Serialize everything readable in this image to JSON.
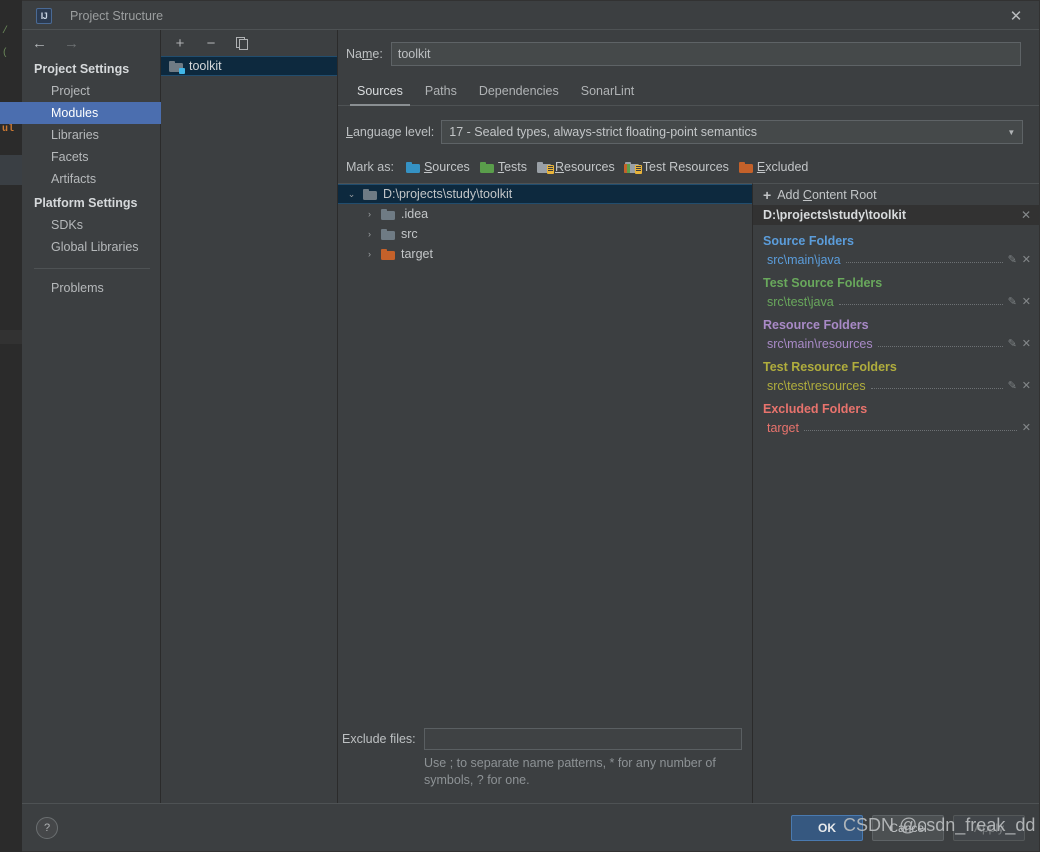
{
  "window": {
    "title": "Project Structure",
    "app_icon": "intellij-idea-icon",
    "close_label": "✕"
  },
  "nav": {
    "back_icon": "←",
    "forward_icon": "→",
    "groups": [
      {
        "label": "Project Settings",
        "items": [
          {
            "label": "Project",
            "selected": false
          },
          {
            "label": "Modules",
            "selected": true
          },
          {
            "label": "Libraries",
            "selected": false
          },
          {
            "label": "Facets",
            "selected": false
          },
          {
            "label": "Artifacts",
            "selected": false
          }
        ]
      },
      {
        "label": "Platform Settings",
        "items": [
          {
            "label": "SDKs",
            "selected": false
          },
          {
            "label": "Global Libraries",
            "selected": false
          }
        ]
      }
    ],
    "problems": "Problems"
  },
  "modules": {
    "toolbar": {
      "add": "+",
      "remove": "−",
      "copy": "copy-icon"
    },
    "items": [
      {
        "label": "toolkit",
        "selected": true
      }
    ]
  },
  "detail": {
    "name_label_pre": "Na",
    "name_label_mnemonic": "m",
    "name_label_post": "e:",
    "name_value": "toolkit",
    "name_placeholder": "",
    "tabs": [
      {
        "label": "Sources",
        "active": true
      },
      {
        "label": "Paths",
        "active": false
      },
      {
        "label": "Dependencies",
        "active": false
      },
      {
        "label": "SonarLint",
        "active": false
      }
    ],
    "language_level": {
      "label_pre": "",
      "label_mnemonic": "L",
      "label_post": "anguage level:",
      "value": "17 - Sealed types, always-strict floating-point semantics",
      "caret": "▼"
    },
    "mark_as": {
      "label": "Mark as:",
      "options": [
        {
          "label": "Sources",
          "mnemonic": "S",
          "rest": "ources",
          "icon": "folder-sources-icon",
          "color": "#3592c4"
        },
        {
          "label": "Tests",
          "mnemonic": "T",
          "rest": "ests",
          "icon": "folder-tests-icon",
          "color": "#5a9e4b"
        },
        {
          "label": "Resources",
          "mnemonic": "R",
          "rest": "esources",
          "icon": "folder-resources-icon",
          "color": "#9aa0a6"
        },
        {
          "label": "Test Resources",
          "mnemonic": "",
          "rest": "Test Resources",
          "icon": "folder-test-resources-icon",
          "color": "#9aa0a6"
        },
        {
          "label": "Excluded",
          "mnemonic": "E",
          "rest": "xcluded",
          "icon": "folder-excluded-icon",
          "color": "#c4612a"
        }
      ]
    },
    "tree": [
      {
        "label": "D:\\projects\\study\\toolkit",
        "twisty": "⌄",
        "indent": 0,
        "folder": "blue",
        "selected": true
      },
      {
        "label": ".idea",
        "twisty": "›",
        "indent": 1,
        "folder": "blue",
        "selected": false
      },
      {
        "label": "src",
        "twisty": "›",
        "indent": 1,
        "folder": "blue",
        "selected": false
      },
      {
        "label": "target",
        "twisty": "›",
        "indent": 1,
        "folder": "orange",
        "selected": false
      }
    ],
    "exclude": {
      "label": "Exclude files:",
      "value": "",
      "placeholder": "",
      "hint": "Use ; to separate name patterns, * for any number of symbols, ? for one."
    }
  },
  "roots": {
    "add_content_root": {
      "plus": "+",
      "text_pre": "Add ",
      "mnemonic": "C",
      "text_post": "ontent Root"
    },
    "root_path": "D:\\projects\\study\\toolkit",
    "root_close": "✕",
    "categories": [
      {
        "title": "Source Folders",
        "color_class": "c-src",
        "color": "#5b9ddb",
        "entries": [
          {
            "path": "src\\main\\java",
            "has_pencil": true,
            "has_close": true
          }
        ]
      },
      {
        "title": "Test Source Folders",
        "color_class": "c-test",
        "color": "#69a85c",
        "entries": [
          {
            "path": "src\\test\\java",
            "has_pencil": true,
            "has_close": true
          }
        ]
      },
      {
        "title": "Resource Folders",
        "color_class": "c-res",
        "color": "#a98ac7",
        "entries": [
          {
            "path": "src\\main\\resources",
            "has_pencil": true,
            "has_close": true
          }
        ]
      },
      {
        "title": "Test Resource Folders",
        "color_class": "c-tres",
        "color": "#b0ad3d",
        "entries": [
          {
            "path": "src\\test\\resources",
            "has_pencil": true,
            "has_close": true
          }
        ]
      },
      {
        "title": "Excluded Folders",
        "color_class": "c-exc",
        "color": "#e8736d",
        "entries": [
          {
            "path": "target",
            "has_pencil": false,
            "has_close": true
          }
        ]
      }
    ],
    "pencil_icon": "✎",
    "close_icon": "✕"
  },
  "footer": {
    "help": "?",
    "ok": "OK",
    "cancel": "Cancel",
    "apply": "Apply"
  },
  "watermark": "CSDN @csdn_freak_dd",
  "editor_behind": {
    "line1": "/",
    "line2": "(",
    "line3": "ul"
  },
  "theme": {
    "bg": "#3c3f41",
    "selection": "#4b6eaf",
    "tree_selection": "#0d293e",
    "primary_button": "#365880",
    "text": "#bdc0c2"
  }
}
